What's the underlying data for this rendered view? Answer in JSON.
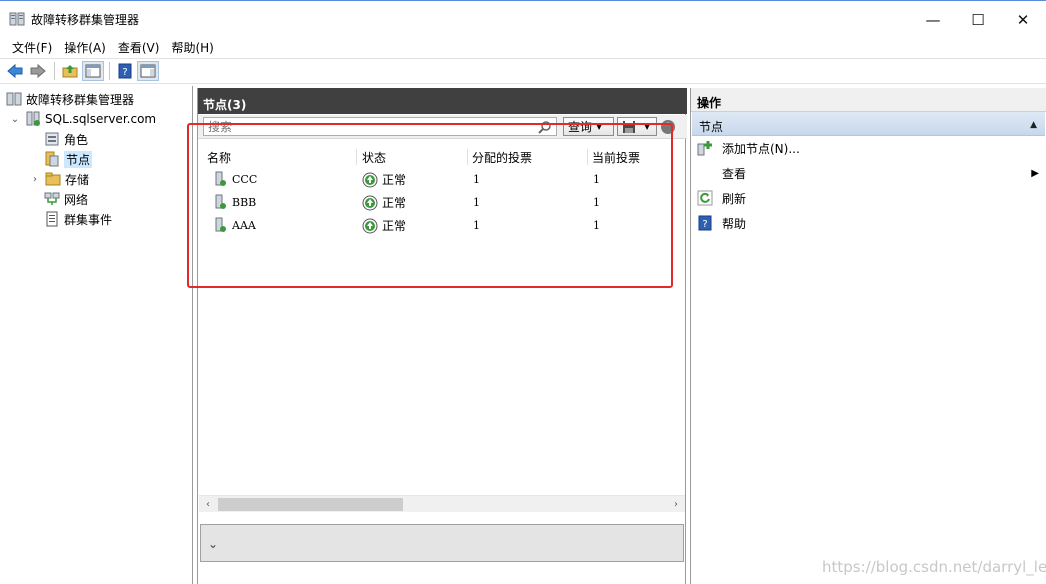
{
  "window": {
    "title": "故障转移群集管理器",
    "minimize": "—",
    "maximize": "☐",
    "close": "✕"
  },
  "menu": [
    "文件(F)",
    "操作(A)",
    "查看(V)",
    "帮助(H)"
  ],
  "tree": {
    "root": "故障转移群集管理器",
    "cluster": "SQL.sqlserver.com",
    "roles": "角色",
    "nodes": "节点",
    "storage": "存储",
    "networks": "网络",
    "cluster_events": "群集事件"
  },
  "center": {
    "header": "节点(3)",
    "search_placeholder": "搜索",
    "query_label": "查询",
    "columns": [
      "名称",
      "状态",
      "分配的投票",
      "当前投票"
    ],
    "rows": [
      {
        "name": "CCC",
        "status": "正常",
        "assigned_vote": "1",
        "current_vote": "1"
      },
      {
        "name": "BBB",
        "status": "正常",
        "assigned_vote": "1",
        "current_vote": "1"
      },
      {
        "name": "AAA",
        "status": "正常",
        "assigned_vote": "1",
        "current_vote": "1"
      }
    ]
  },
  "actions": {
    "header": "操作",
    "group": "节点",
    "items": {
      "add_node": "添加节点(N)...",
      "view": "查看",
      "refresh": "刷新",
      "help": "帮助"
    }
  },
  "watermark": "https://blog.csdn.net/darryl_lee",
  "colors": {
    "highlight_box": "#e22a2a",
    "center_header_bg": "#404040",
    "status_ok": "#3a9a3a",
    "selection": "#cce8ff"
  }
}
